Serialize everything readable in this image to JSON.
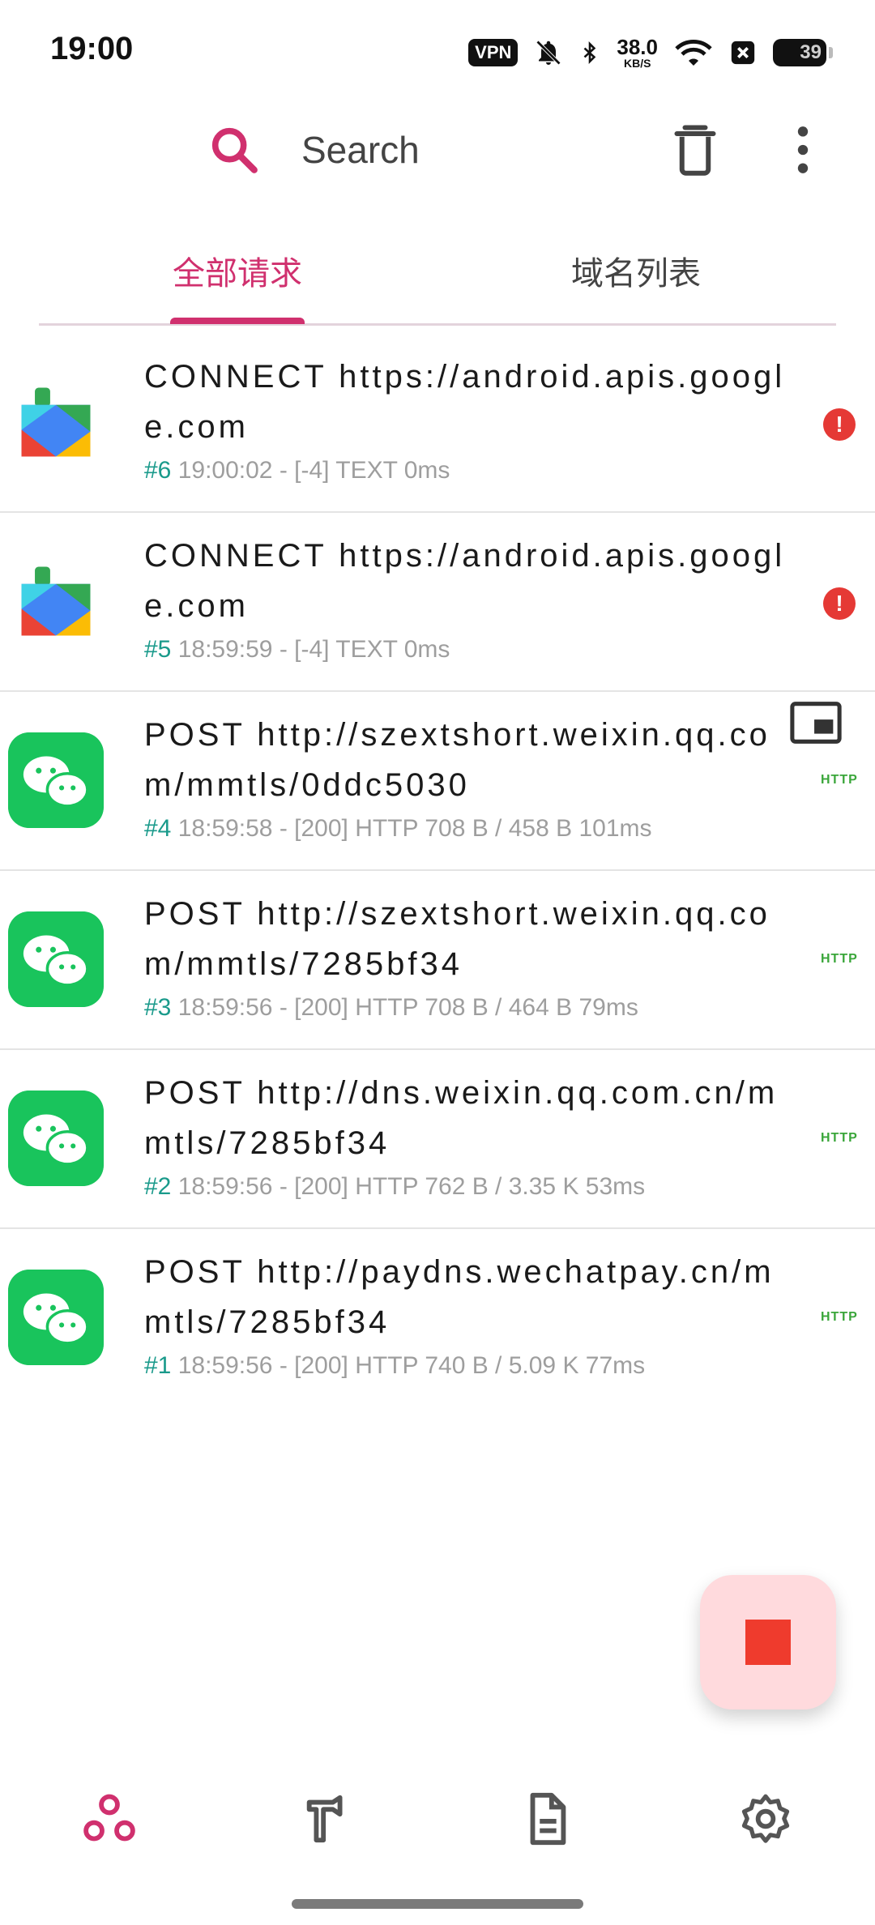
{
  "status_bar": {
    "time": "19:00",
    "vpn": "VPN",
    "net_speed": "38.0",
    "net_unit": "KB/S",
    "battery": "39"
  },
  "app_bar": {
    "search_placeholder": "Search",
    "icons": [
      "search-icon",
      "trash-icon",
      "more-vert-icon"
    ]
  },
  "tabs": [
    {
      "label": "全部请求",
      "active": true
    },
    {
      "label": "域名列表",
      "active": false
    }
  ],
  "requests": [
    {
      "app": "google-play-services",
      "title": "CONNECT https://android.apis.google.com",
      "id": "#6",
      "meta": " 19:00:02 - [-4] TEXT  0ms",
      "badge": "error"
    },
    {
      "app": "google-play-services",
      "title": "CONNECT https://android.apis.google.com",
      "id": "#5",
      "meta": " 18:59:59 - [-4] TEXT  0ms",
      "badge": "error"
    },
    {
      "app": "wechat",
      "title": "POST http://szextshort.weixin.qq.com/mmtls/0ddc5030",
      "id": "#4",
      "meta": " 18:59:58 - [200] HTTP 708 B / 458 B  101ms",
      "badge": "HTTP"
    },
    {
      "app": "wechat",
      "title": "POST http://szextshort.weixin.qq.com/mmtls/7285bf34",
      "id": "#3",
      "meta": " 18:59:56 - [200] HTTP 708 B / 464 B  79ms",
      "badge": "HTTP"
    },
    {
      "app": "wechat",
      "title": "POST http://dns.weixin.qq.com.cn/mmtls/7285bf34",
      "id": "#2",
      "meta": " 18:59:56 - [200] HTTP 762 B / 3.35 K  53ms",
      "badge": "HTTP"
    },
    {
      "app": "wechat",
      "title": "POST http://paydns.wechatpay.cn/mmtls/7285bf34",
      "id": "#1",
      "meta": " 18:59:56 - [200] HTTP 740 B / 5.09 K  77ms",
      "badge": "HTTP"
    }
  ],
  "bottom_nav": [
    "network-icon",
    "tools-icon",
    "document-icon",
    "settings-icon"
  ],
  "colors": {
    "accent": "#d0306e",
    "id": "#1a9a8b",
    "http": "#3aa63a",
    "error": "#e53935",
    "fab_bg": "#ffdadd",
    "fab_stop": "#ef3b2d"
  }
}
